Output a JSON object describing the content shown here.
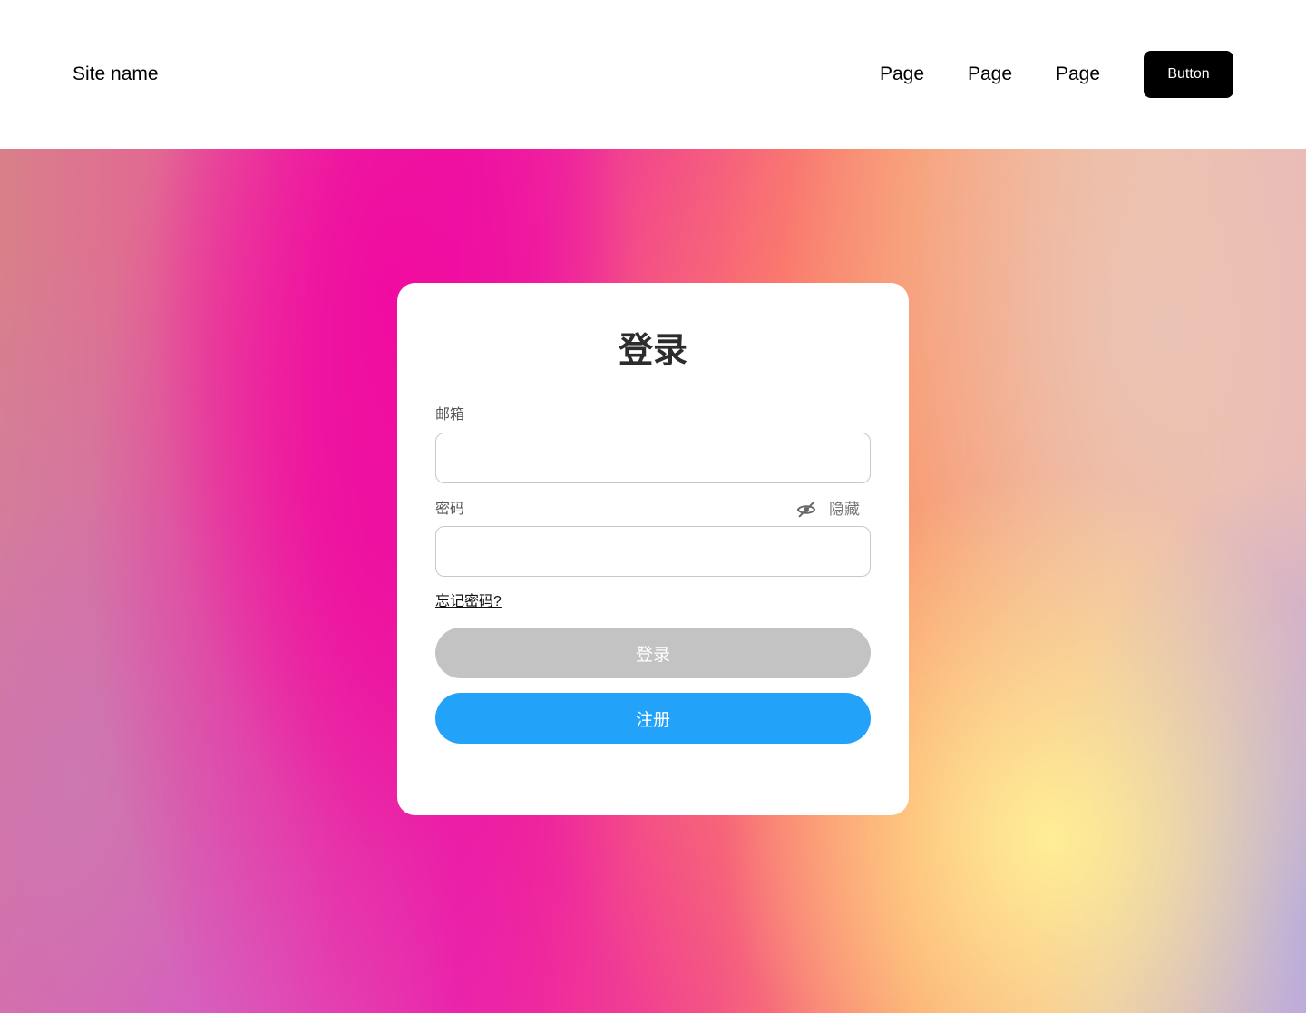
{
  "header": {
    "site_name": "Site name",
    "nav": [
      "Page",
      "Page",
      "Page"
    ],
    "button_label": "Button"
  },
  "login": {
    "title": "登录",
    "email_label": "邮箱",
    "email_value": "",
    "password_label": "密码",
    "password_value": "",
    "toggle_label": "隐藏",
    "toggle_icon": "eye-slash-icon",
    "forgot_label": "忘记密码?",
    "login_button": "登录",
    "register_button": "注册"
  },
  "colors": {
    "header_button_bg": "#000000",
    "login_button_bg": "#c3c3c3",
    "register_button_bg": "#22a2f8",
    "card_bg": "#ffffff"
  }
}
